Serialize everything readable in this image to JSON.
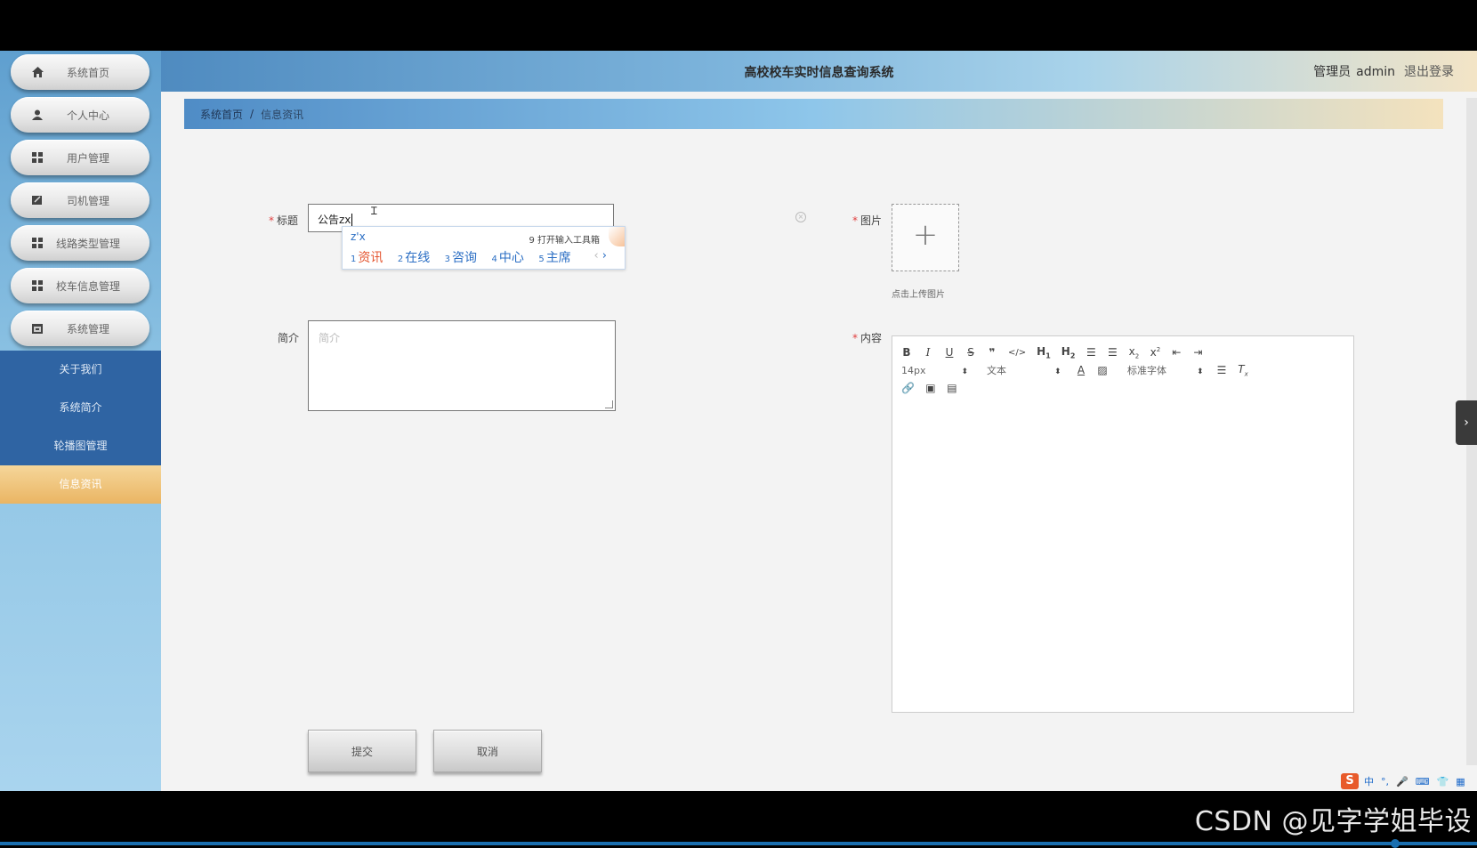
{
  "app": {
    "title": "高校校车实时信息查询系统",
    "user_role": "管理员",
    "user_name": "admin",
    "logout_label": "退出登录"
  },
  "sidebar": {
    "items": [
      {
        "label": "系统首页",
        "icon": "home-icon"
      },
      {
        "label": "个人中心",
        "icon": "user-icon"
      },
      {
        "label": "用户管理",
        "icon": "grid-icon"
      },
      {
        "label": "司机管理",
        "icon": "edit-icon"
      },
      {
        "label": "线路类型管理",
        "icon": "grid-icon"
      },
      {
        "label": "校车信息管理",
        "icon": "grid-icon"
      },
      {
        "label": "系统管理",
        "icon": "calendar-icon"
      }
    ],
    "submenu": [
      {
        "label": "关于我们"
      },
      {
        "label": "系统简介"
      },
      {
        "label": "轮播图管理"
      },
      {
        "label": "信息资讯",
        "active": true
      }
    ]
  },
  "breadcrumb": {
    "home": "系统首页",
    "separator": "/",
    "current": "信息资讯"
  },
  "form": {
    "title_label": "标题",
    "title_value": "公告zx",
    "summary_label": "简介",
    "summary_placeholder": "简介",
    "image_label": "图片",
    "upload_hint": "点击上传图片",
    "content_label": "内容",
    "submit_label": "提交",
    "cancel_label": "取消"
  },
  "ime_popup": {
    "pinyin": "z'x",
    "tool_hint": "9 打开输入工具箱",
    "candidates": [
      {
        "num": "1",
        "text": "资讯"
      },
      {
        "num": "2",
        "text": "在线"
      },
      {
        "num": "3",
        "text": "咨询"
      },
      {
        "num": "4",
        "text": "中心"
      },
      {
        "num": "5",
        "text": "主席"
      }
    ]
  },
  "editor_toolbar": {
    "font_size": "14px",
    "text_type": "文本",
    "font_family": "标准字体"
  },
  "ime_status": {
    "items": [
      "中",
      "°,",
      "🎤",
      "⌨",
      "👕",
      "▦"
    ]
  },
  "watermark": "CSDN @见字学姐毕设",
  "colors": {
    "submenu_bg": "#2f64a3",
    "active_item": "#eab563",
    "required": "#e04040"
  }
}
